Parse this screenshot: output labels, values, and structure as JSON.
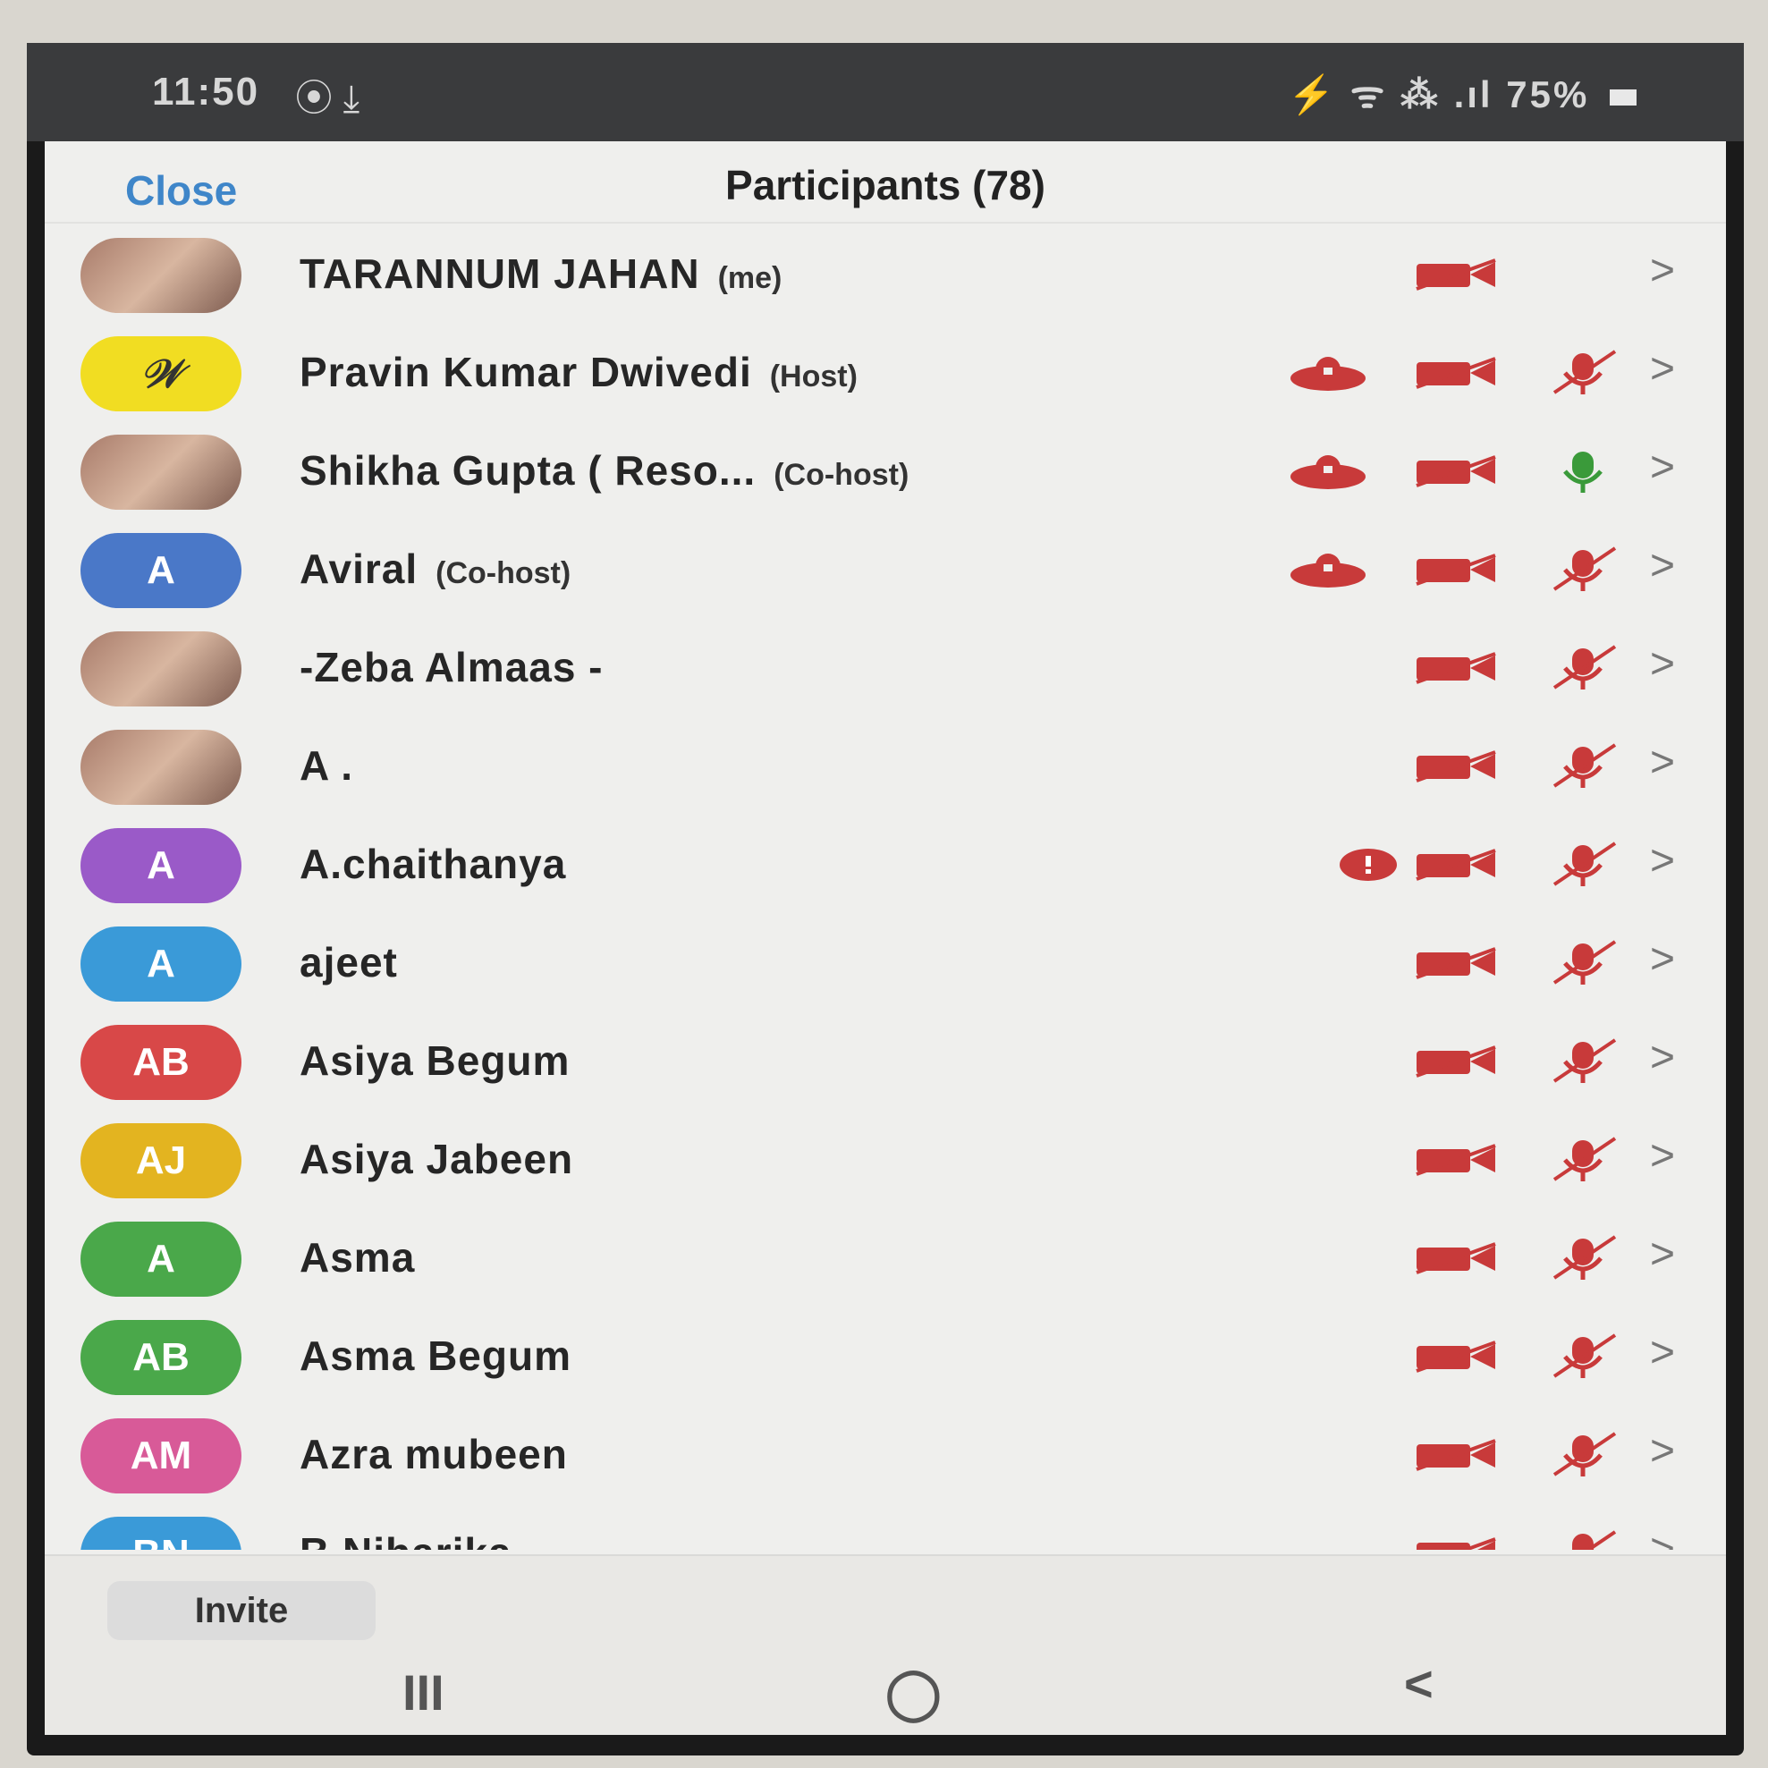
{
  "status": {
    "time": "11:50",
    "apps": "⦿ ⤓",
    "signal": "⚡ ᯤ ⁂ .ıl",
    "battery": "75%"
  },
  "header": {
    "close": "Close",
    "title": "Participants (78)"
  },
  "participants": [
    {
      "name": "TARANNUM JAHAN",
      "role": "(me)",
      "avatar": "",
      "avatar_color": "photo",
      "cloud": false,
      "alert": false,
      "mic": "none"
    },
    {
      "name": "Pravin Kumar Dwivedi",
      "role": "(Host)",
      "avatar": "𝒲",
      "avatar_color": "logo",
      "cloud": true,
      "alert": false,
      "mic": "muted"
    },
    {
      "name": "Shikha Gupta ( Reso...",
      "role": "(Co-host)",
      "avatar": "",
      "avatar_color": "photo",
      "cloud": true,
      "alert": false,
      "mic": "on"
    },
    {
      "name": "Aviral",
      "role": "(Co-host)",
      "avatar": "A",
      "avatar_color": "#4a78c8",
      "cloud": true,
      "alert": false,
      "mic": "muted"
    },
    {
      "name": "-Zeba Almaas -",
      "role": "",
      "avatar": "",
      "avatar_color": "photo",
      "cloud": false,
      "alert": false,
      "mic": "muted"
    },
    {
      "name": "A .",
      "role": "",
      "avatar": "",
      "avatar_color": "photo",
      "cloud": false,
      "alert": false,
      "mic": "muted"
    },
    {
      "name": "A.chaithanya",
      "role": "",
      "avatar": "A",
      "avatar_color": "#9a5ac8",
      "cloud": false,
      "alert": true,
      "mic": "muted"
    },
    {
      "name": "ajeet",
      "role": "",
      "avatar": "A",
      "avatar_color": "#3a9ad8",
      "cloud": false,
      "alert": false,
      "mic": "muted"
    },
    {
      "name": "Asiya Begum",
      "role": "",
      "avatar": "AB",
      "avatar_color": "#d84848",
      "cloud": false,
      "alert": false,
      "mic": "muted"
    },
    {
      "name": "Asiya Jabeen",
      "role": "",
      "avatar": "AJ",
      "avatar_color": "#e3b420",
      "cloud": false,
      "alert": false,
      "mic": "muted"
    },
    {
      "name": "Asma",
      "role": "",
      "avatar": "A",
      "avatar_color": "#4aa84a",
      "cloud": false,
      "alert": false,
      "mic": "muted"
    },
    {
      "name": "Asma Begum",
      "role": "",
      "avatar": "AB",
      "avatar_color": "#4aa84a",
      "cloud": false,
      "alert": false,
      "mic": "muted"
    },
    {
      "name": "Azra mubeen",
      "role": "",
      "avatar": "AM",
      "avatar_color": "#d85a98",
      "cloud": false,
      "alert": false,
      "mic": "muted"
    },
    {
      "name": "B Niharika",
      "role": "",
      "avatar": "BN",
      "avatar_color": "#3a9ad8",
      "cloud": false,
      "alert": false,
      "mic": "muted"
    }
  ],
  "invite": "Invite",
  "nav": {
    "recents": "III",
    "home": "◯",
    "back": "<"
  },
  "colors": {
    "accent": "#3f86c9",
    "muted_red": "#c83a3a",
    "mic_green": "#3a9a3a"
  }
}
